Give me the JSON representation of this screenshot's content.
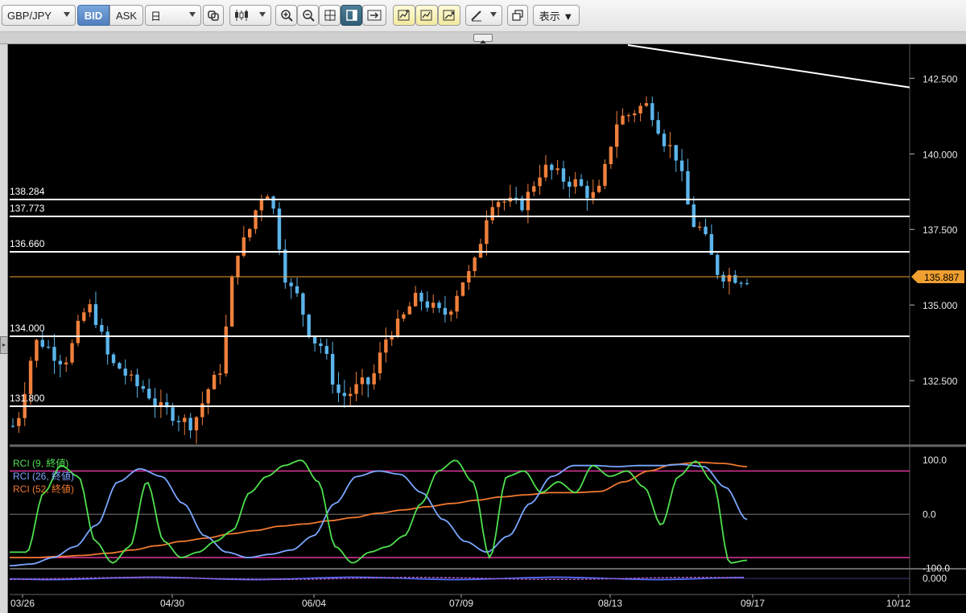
{
  "toolbar": {
    "symbol": "GBP/JPY",
    "bid_label": "BID",
    "ask_label": "ASK",
    "timeframe": "日",
    "display_menu": "表示 ▼"
  },
  "price_axis": {
    "ticks": [
      "142.500",
      "140.000",
      "137.500",
      "135.000",
      "132.500"
    ],
    "current_price": "135.887"
  },
  "horizontal_lines": [
    "138.284",
    "137.773",
    "136.660",
    "134.000",
    "131.800"
  ],
  "date_axis": {
    "ticks": [
      "03/26",
      "04/30",
      "06/04",
      "07/09",
      "08/13",
      "09/17",
      "10/12"
    ]
  },
  "rci": {
    "legend": [
      "RCI (9, 終値)",
      "RCI (26, 終値)",
      "RCI (52, 終値)"
    ],
    "axis_ticks": [
      "100.0",
      "0.0",
      "-100.0"
    ],
    "colors": {
      "rci9": "#4fe04f",
      "rci26": "#7aa6ff",
      "rci52": "#f0782f",
      "band": "#e0359a"
    }
  },
  "bottom_indicator": {
    "axis_tick": "0.000"
  },
  "colors": {
    "up": "#f0803c",
    "down": "#5bb4ea",
    "line": "#ffffff",
    "current_price": "#f0a030"
  },
  "chart_data": {
    "type": "candlestick",
    "title": "",
    "y_range": [
      130.4,
      143.6
    ],
    "dates_shown": [
      "03/26",
      "04/30",
      "06/04",
      "07/09",
      "08/13",
      "09/17",
      "10/12"
    ],
    "closes_approx": [
      131.0,
      133.8,
      133.2,
      134.9,
      133.0,
      132.3,
      131.5,
      131.1,
      132.5,
      137.0,
      138.8,
      135.5,
      133.8,
      132.0,
      132.4,
      134.2,
      135.2,
      134.7,
      136.0,
      138.5,
      138.3,
      139.5,
      139.1,
      138.6,
      141.2,
      141.6,
      140.2,
      137.6,
      136.0,
      135.887
    ],
    "current": 135.887,
    "trendline": {
      "from_price": 143.6,
      "to_price": 142.2
    }
  }
}
